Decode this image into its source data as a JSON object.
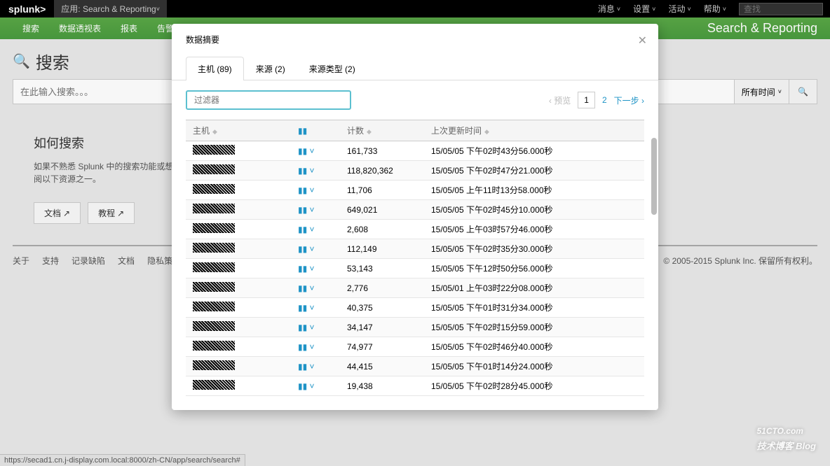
{
  "topbar": {
    "logo": "splunk>",
    "app_label": "应用: Search & Reporting",
    "menu": {
      "messages": "消息",
      "settings": "设置",
      "activity": "活动",
      "help": "帮助"
    },
    "search_placeholder": "查找"
  },
  "navbar": {
    "items": [
      "搜索",
      "数据透视表",
      "报表",
      "告警"
    ],
    "right": "Search & Reporting"
  },
  "search": {
    "title": "搜索",
    "placeholder": "在此输入搜索。。。",
    "time_range": "所有时间"
  },
  "info": {
    "title": "如何搜索",
    "text": "如果不熟悉 Splunk 中的搜索功能或想要了解更多，请参阅以下资源之一。",
    "doc_btn": "文档",
    "tutorial_btn": "教程"
  },
  "footer": {
    "links": [
      "关于",
      "支持",
      "记录缺陷",
      "文档",
      "隐私策略"
    ],
    "copyright": "© 2005-2015 Splunk Inc. 保留所有权利。"
  },
  "modal": {
    "title": "数据摘要",
    "tabs": [
      "主机 (89)",
      "来源 (2)",
      "来源类型 (2)"
    ],
    "filter_placeholder": "过滤器",
    "pager": {
      "prev": "预览",
      "pages": [
        "1",
        "2"
      ],
      "next": "下一步"
    },
    "columns": {
      "host": "主机",
      "spark": "",
      "count": "计数",
      "updated": "上次更新时间"
    },
    "rows": [
      {
        "count": "161,733",
        "updated": "15/05/05 下午02时43分56.000秒"
      },
      {
        "count": "118,820,362",
        "updated": "15/05/05 下午02时47分21.000秒"
      },
      {
        "count": "11,706",
        "updated": "15/05/05 上午11时13分58.000秒"
      },
      {
        "count": "649,021",
        "updated": "15/05/05 下午02时45分10.000秒"
      },
      {
        "count": "2,608",
        "updated": "15/05/05 上午03时57分46.000秒"
      },
      {
        "count": "112,149",
        "updated": "15/05/05 下午02时35分30.000秒"
      },
      {
        "count": "53,143",
        "updated": "15/05/05 下午12时50分56.000秒"
      },
      {
        "count": "2,776",
        "updated": "15/05/01 上午03时22分08.000秒"
      },
      {
        "count": "40,375",
        "updated": "15/05/05 下午01时31分34.000秒"
      },
      {
        "count": "34,147",
        "updated": "15/05/05 下午02时15分59.000秒"
      },
      {
        "count": "74,977",
        "updated": "15/05/05 下午02时46分40.000秒"
      },
      {
        "count": "44,415",
        "updated": "15/05/05 下午01时14分24.000秒"
      },
      {
        "count": "19,438",
        "updated": "15/05/05 下午02时28分45.000秒"
      }
    ]
  },
  "status_bar": "https://secad1.cn.j-display.com.local:8000/zh-CN/app/search/search#",
  "watermark": {
    "main": "51CTO.com",
    "sub": "技术博客  Blog"
  }
}
